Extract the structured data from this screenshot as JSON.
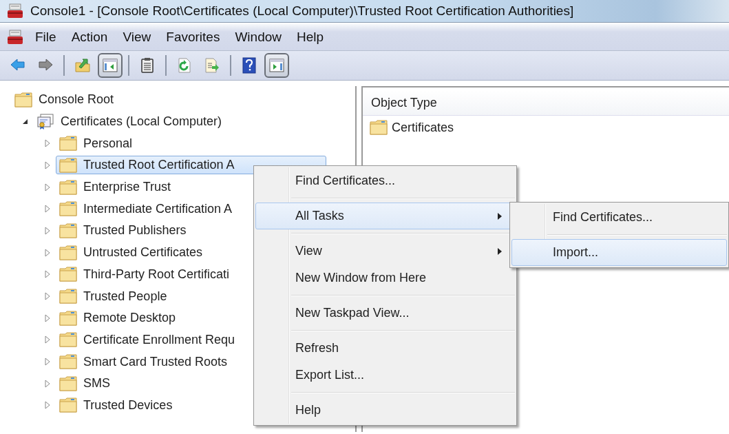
{
  "window": {
    "title": "Console1 - [Console Root\\Certificates (Local Computer)\\Trusted Root Certification Authorities]"
  },
  "menu_bar": {
    "items": [
      "File",
      "Action",
      "View",
      "Favorites",
      "Window",
      "Help"
    ]
  },
  "toolbar": {
    "groups": [
      [
        {
          "pressed": false
        },
        {
          "pressed": false
        }
      ],
      [
        {
          "pressed": false
        },
        {
          "pressed": true
        }
      ],
      [
        {
          "pressed": false
        }
      ],
      [
        {
          "pressed": false
        },
        {
          "pressed": false
        }
      ],
      [
        {
          "pressed": false
        },
        {
          "pressed": true
        }
      ]
    ]
  },
  "tree": {
    "label": "Console Root",
    "kind": "folder",
    "selected": false,
    "children": [
      {
        "label": "Certificates (Local Computer)",
        "kind": "certificate",
        "selected": false,
        "expanded": true,
        "children": [
          {
            "label": "Personal",
            "kind": "folder",
            "selected": false,
            "expanded": false
          },
          {
            "label": "Trusted Root Certification A",
            "kind": "folder",
            "selected": true,
            "expanded": false
          },
          {
            "label": "Enterprise Trust",
            "kind": "folder",
            "selected": false,
            "expanded": false
          },
          {
            "label": "Intermediate Certification A",
            "kind": "folder",
            "selected": false,
            "expanded": false
          },
          {
            "label": "Trusted Publishers",
            "kind": "folder",
            "selected": false,
            "expanded": false
          },
          {
            "label": "Untrusted Certificates",
            "kind": "folder",
            "selected": false,
            "expanded": false
          },
          {
            "label": "Third-Party Root Certificati",
            "kind": "folder",
            "selected": false,
            "expanded": false
          },
          {
            "label": "Trusted People",
            "kind": "folder",
            "selected": false,
            "expanded": false
          },
          {
            "label": "Remote Desktop",
            "kind": "folder",
            "selected": false,
            "expanded": false
          },
          {
            "label": "Certificate Enrollment Requ",
            "kind": "folder",
            "selected": false,
            "expanded": false
          },
          {
            "label": "Smart Card Trusted Roots",
            "kind": "folder",
            "selected": false,
            "expanded": false
          },
          {
            "label": "SMS",
            "kind": "folder",
            "selected": false,
            "expanded": false
          },
          {
            "label": "Trusted Devices",
            "kind": "folder",
            "selected": false,
            "expanded": false
          }
        ]
      }
    ]
  },
  "list": {
    "columns": [
      "Object Type"
    ],
    "rows": [
      {
        "name": "Certificates"
      }
    ]
  },
  "context_menu": {
    "items": [
      {
        "kind": "item",
        "label": "Find Certificates...",
        "submenu": false,
        "selected": false
      },
      {
        "kind": "separator"
      },
      {
        "kind": "item",
        "label": "All Tasks",
        "submenu": true,
        "selected": true
      },
      {
        "kind": "separator"
      },
      {
        "kind": "item",
        "label": "View",
        "submenu": true,
        "selected": false
      },
      {
        "kind": "item",
        "label": "New Window from Here",
        "submenu": false,
        "selected": false
      },
      {
        "kind": "separator"
      },
      {
        "kind": "item",
        "label": "New Taskpad View...",
        "submenu": false,
        "selected": false
      },
      {
        "kind": "separator"
      },
      {
        "kind": "item",
        "label": "Refresh",
        "submenu": false,
        "selected": false
      },
      {
        "kind": "item",
        "label": "Export List...",
        "submenu": false,
        "selected": false
      },
      {
        "kind": "separator"
      },
      {
        "kind": "item",
        "label": "Help",
        "submenu": false,
        "selected": false
      }
    ]
  },
  "submenu": {
    "items": [
      {
        "kind": "item",
        "label": "Find Certificates...",
        "submenu": false,
        "selected": false
      },
      {
        "kind": "separator"
      },
      {
        "kind": "item",
        "label": "Import...",
        "submenu": false,
        "selected": true
      }
    ]
  }
}
